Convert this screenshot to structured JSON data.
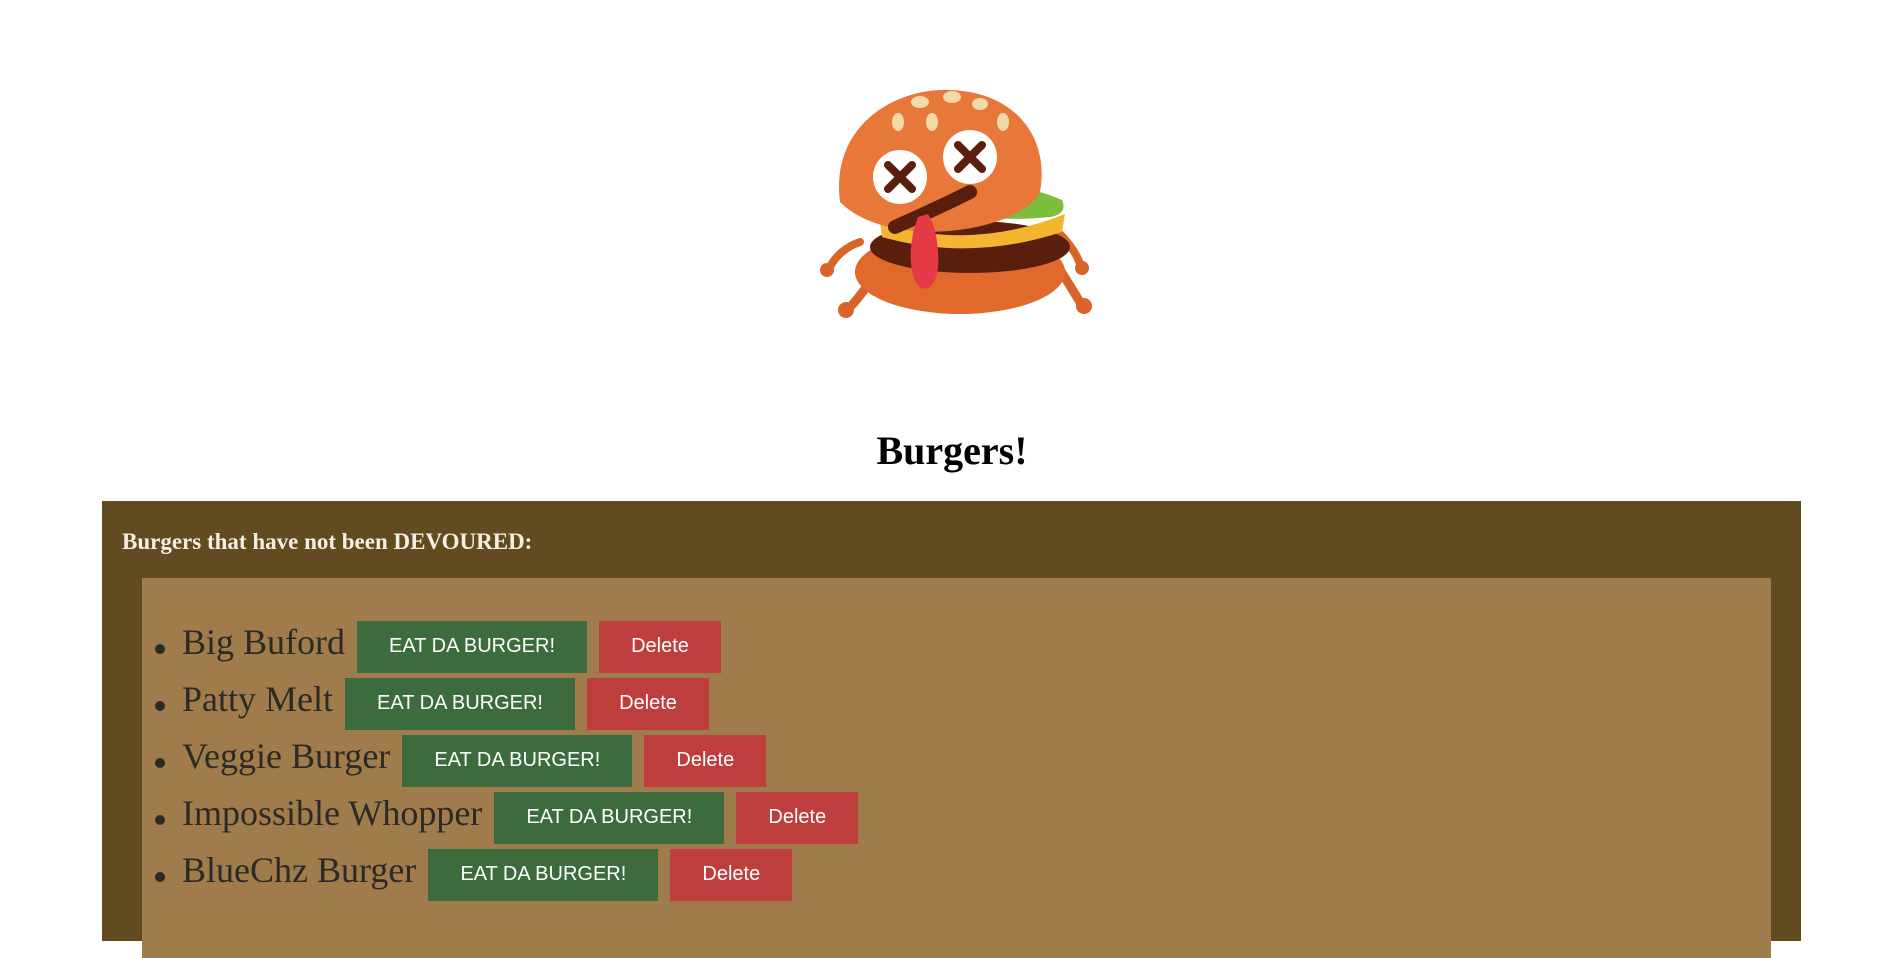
{
  "page": {
    "title": "Burgers!",
    "logo_icon": "dizzy-burger-mascot-icon"
  },
  "panel": {
    "heading": "Burgers that have not been DEVOURED:",
    "colors": {
      "panel_bg": "#624a21",
      "body_bg": "#a07c4c",
      "eat_button": "#3c6b3e",
      "delete_button": "#be3e3e"
    }
  },
  "burgers": [
    {
      "name": "Big Buford",
      "eat_label": "EAT DA BURGER!",
      "delete_label": "Delete"
    },
    {
      "name": "Patty Melt",
      "eat_label": "EAT DA BURGER!",
      "delete_label": "Delete"
    },
    {
      "name": "Veggie Burger",
      "eat_label": "EAT DA BURGER!",
      "delete_label": "Delete"
    },
    {
      "name": "Impossible Whopper",
      "eat_label": "EAT DA BURGER!",
      "delete_label": "Delete"
    },
    {
      "name": "BlueChz Burger",
      "eat_label": "EAT DA BURGER!",
      "delete_label": "Delete"
    }
  ]
}
